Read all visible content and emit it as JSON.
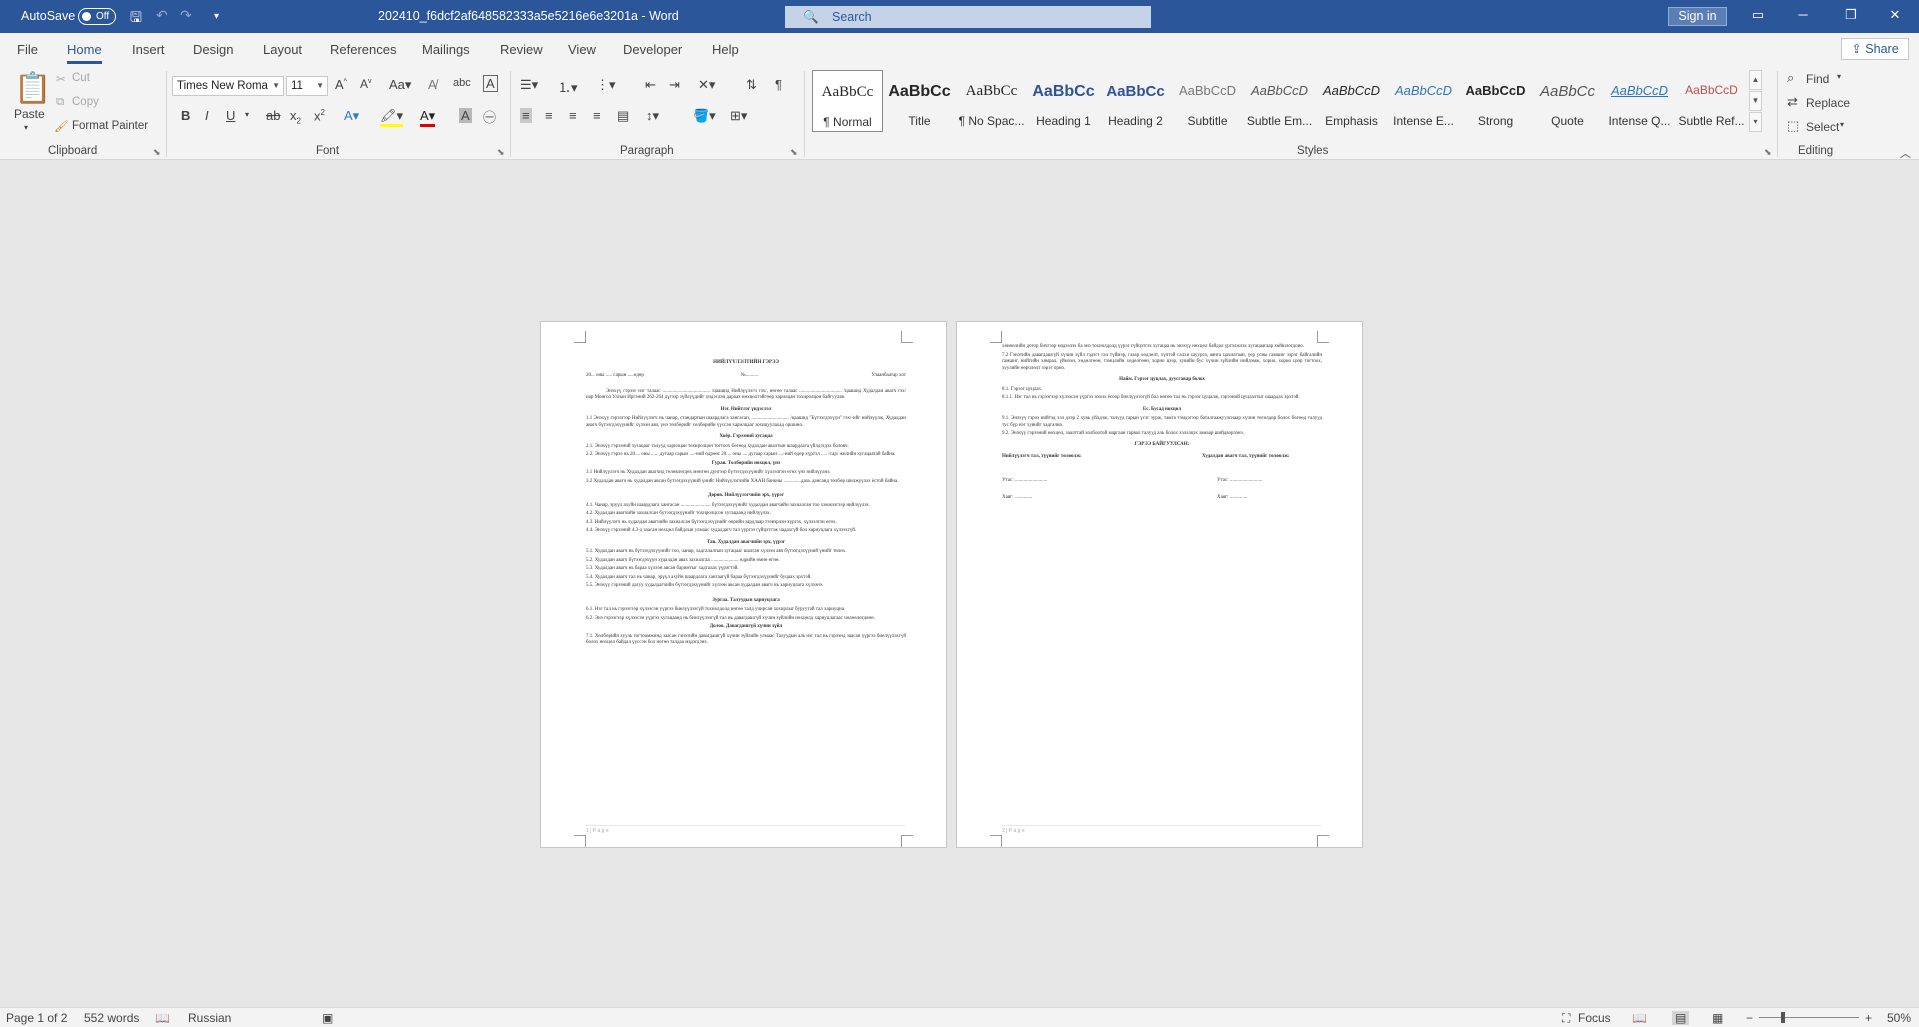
{
  "titlebar": {
    "autosave_label": "AutoSave",
    "autosave_state": "Off",
    "doc_title": "202410_f6dcf2af648582333a5e5216e6e3201a  -  Word",
    "search_placeholder": "Search",
    "signin": "Sign in"
  },
  "tabs": [
    "File",
    "Home",
    "Insert",
    "Design",
    "Layout",
    "References",
    "Mailings",
    "Review",
    "View",
    "Developer",
    "Help"
  ],
  "share": "Share",
  "ribbon": {
    "clipboard": {
      "paste": "Paste",
      "cut": "Cut",
      "copy": "Copy",
      "format_painter": "Format Painter",
      "label": "Clipboard"
    },
    "font": {
      "family": "Times New Roma",
      "size": "11",
      "label": "Font"
    },
    "paragraph": {
      "label": "Paragraph"
    },
    "styles": {
      "label": "Styles",
      "items": [
        {
          "preview": "AaBbCc",
          "name": "¶ Normal"
        },
        {
          "preview": "AaBbCc",
          "name": "Title"
        },
        {
          "preview": "AaBbCc",
          "name": "¶ No Spac..."
        },
        {
          "preview": "AaBbCc",
          "name": "Heading 1"
        },
        {
          "preview": "AaBbCc",
          "name": "Heading 2"
        },
        {
          "preview": "AaBbCcD",
          "name": "Subtitle"
        },
        {
          "preview": "AaBbCcD",
          "name": "Subtle Em..."
        },
        {
          "preview": "AaBbCcD",
          "name": "Emphasis"
        },
        {
          "preview": "AaBbCcD",
          "name": "Intense E..."
        },
        {
          "preview": "AaBbCcD",
          "name": "Strong"
        },
        {
          "preview": "AaBbCc",
          "name": "Quote"
        },
        {
          "preview": "AaBbCcD",
          "name": "Intense Q..."
        },
        {
          "preview": "AaBbCcD",
          "name": "Subtle Ref..."
        }
      ]
    },
    "editing": {
      "find": "Find",
      "replace": "Replace",
      "select": "Select",
      "label": "Editing"
    }
  },
  "page1": {
    "title": "НИЙЛҮҮЛЭЛТИЙН ГЭРЭЭ",
    "date_line": "20... оны ..... сарын .....өдөр",
    "number": "№..........",
    "city": "Улаанбаатар хот",
    "intro": "Энэхүү гэрээг нэг талаас ...................................... /цаашид Нийлүүлэгч гэх/, нөгөө талаас .................................. /цаашид Худалдан авагч гэх/ нар Монгол Улсын Иргэний 262-264 дүгээр зүйлүүдийг үндэслэн дараах нөхцөлтэйгөөр харилцан тохиролцон байгуулав.",
    "s1": "Нэг. Нийтлэг үндэслэл",
    "s1_1": "1.1  Энэхүү гэрээгээр Нийлүүлэгч нь чанар, стандартын шаардлага хангасан, .............................. /цаашид \"Бүтээгдэхүүн\" гэх/-ийг нийлүүлж, Худалдан авагч бүтээгдэхүүнийг хүлээн авч, үнэ төлбөрийг хөлбөрийн үүссэн харилцааг зохицуулахад оршино.",
    "s2": "Хоёр. Гэрээний хугацаа",
    "s2_1": "2.1. Энэхүү гэрээний хугацааг талууд харилцан тохиролцон тогтоох бөгөөд худалдан авалтын шаардлага үйлдэгдэх боловч.",
    "s2_2": "2.2. Энэхүү гэрээ нь 20.... оны ...... дугаар сарын ....-ний өдрөөс 20.... оны .... дугаар сарын ....-ний өдөр хүртэл ..... /сар/ жилийн хугацаатай байна.",
    "s3": "Гурав. Төлбөрийн нөхцөл, үнэ",
    "s3_1": "3.1  Нийлүүлэгч нь Худалдан авагчид төлөвлөгдөх мөнгөн дүнгээр бүтээгдэхүүнийг хүлээлгэн өгөх үнэ нийлүүлнэ.",
    "s3_2": "3.2  Худалдан авагч нь худалдан авсан бүтээгдэхүүний үнийг Нийлүүлэгчийн ХААН банкны ..............дахь дансанд төлбөр шилжүүлэх ёстой байна.",
    "s4": "Дөрөв. Нийлүүлэгчийн эрх, үүрэг",
    "s4_1": "4.1. Чанар, эрүүл ахуйн шаардлага хангасан ........................ бүтээгдэхүүнийг худалдан авагчийн захиалсан тоо хэмжээгээр нийлүүлэх.",
    "s4_2": "4.2. Худалдан авагчийн захиалсан бүтээгдэхүүнийг тохиролцсон хугацаанд нийлүүлэх.",
    "s4_3": "4.3. Нийлүүлэгч нь худалдан авагчийн захиалсан бүтээгдэхүүнийг өөрийн зардлаар тээвэрлэн хүргэх, хүлээлгэн өгөх.",
    "s4_4": "4.4. Энэхүү гэрээний 4.3-д заасан нөхцөл байдлын улмаас худалдагч тал үүргээ гүйцэтгэж чадахгүй бол хариуцлага хүлээхгүй.",
    "s5": "Тав. Худалдан авагчийн эрх, үүрэг",
    "s5_1": "5.1. Худалдан авагч нь бүтээгдэхүүнийг тоо, чанар, хадгалалтын хугацааг шалган хүлээн авч бүтээгдэхүүний үнийг төлөх.",
    "s5_2": "5.2. Худалдан авагч бүтээгдэхүүн худалдан авах захиалгаа ...................... өдрийн өмнө өгнө.",
    "s5_3": "5.3. Худалдан авагч нь бараа хүлээн авсан баримтыг хадгалах үүрэгтэй.",
    "s5_4": "5.4. Худалдан авагч тал нь чанар, эрүүл ахуйн шаардлага хангаагүй бараа бүтээгдэхүүнийг буцаах эрхтэй.",
    "s5_5": "5.5. Энэхүү гэрээний дагуу худалдагчийн бүтээгдэхүүнийг хүлээн авсан худалдан авагч нь хариуцлага хүлээнэ.",
    "s6": "Зургаа. Талуудын хариуцлага",
    "s6_1": "6.1. Нэг тал нь гэрээгээр хүлээсэн үүргээ биелүүлээгүй тохиолдолд нөгөө талд учирсан хохирлыг буруутай тал хариуцна.",
    "s6_2": "6.2. Энэ гэрээгээр хүлээсэн үүргээ хугацаанд нь биелүүлээгүй тал нь давагдашгүй хүчин зүйлийн нөхцөлд хариуцлагаас чөлөөлөгдөнө.",
    "s7": "Долоо. Давагдашгүй хүчин зүйл",
    "s7_1": "7.1. Хөлбөрийн хууль тогтоомжинд заасан гэнэтийн давагдашгүй хүчин зүйлийн улмаас Талуудын аль нэг тал нь гэрээнд заасан үүргээ биелүүлэхгүй болох нөхцөл байдал үүссэн бол нөгөө талдаа мэдэгдэнэ.",
    "page_num": "1 | P a g e"
  },
  "page2": {
    "cont": "хөнөөлийн дотор бичгээр мэдээлэх ба энэ тохиолдолд үүрэг гүйцэтгэх хугацаа нь энэхүү нөхцөл байдал үргэлжлэх хугацаагаар хойшлогдоно.",
    "p7_2": "7.2 Гэнэтийн давагдашгүй хүчин зүйл гэдэгт гал түймэр, газар хөдлөлт, хүчтэй салхи шуурга, аянга цахилгаан, үер усны гамшиг зэрэг байгалийн гамшиг, нийтийн хямрал, үймээн, хөдөлгөөн, тэмцлийн хөдөлгөөн, хорио цээр, хувийн бус хүчин зүйлийн нийлэмж, хорио, хорио цээр тогтоох, хуулийн өөрчлөлт зэрэг орно.",
    "s8": "Найм. Гэрээг цуцлах, дуусгавар болох",
    "s8_1": "8.1. Гэрээг цуцлах",
    "s8_1_1": "8.1.1. Нэг тал нь гэрээгээр хүлээсэн үүргээ зохих ёсоор биелүүлээгүй бол нөгөө тал нь гэрээг цуцалж, гэрээний цуцлалтыг шаардах эрхтэй.",
    "s9": "Ес. Бусад нөхцөл",
    "s9_1": "9.1. Энэхүү гэрээ нийтэд хэл дээр 2 хувь үйлдэж, талууд гарын үсэг зурж, тамга тэмдэгээр баталгаажуулснаар хүчин төгөлдөр болох бөгөөд талууд тус бүр нэг хувийг хадгална.",
    "s9_2": "9.2. Энэхүү гэрээний нөхцөл, заалттай холбоотой маргаан гарвал талууд аль болох хэлэлцэх замаар шийдвэрлэнэ.",
    "signatures_title": "ГЭРЭЭ БАЙГУУЛСАН:",
    "left_rep": "Нийлүүлэгч тал, түүнийг төлөөлж:",
    "right_rep": "Худалдан авагч тал, түүнийг төлөөлж:",
    "left_phone": "Утас: ..........................",
    "right_phone": "Утас: ..........................",
    "left_addr": "Хаяг: ..............",
    "right_addr": "Хаяг: ..............",
    "page_num": "2 | P a g e"
  },
  "status": {
    "page": "Page 1 of 2",
    "words": "552 words",
    "language": "Russian",
    "focus": "Focus",
    "zoom": "50%"
  }
}
